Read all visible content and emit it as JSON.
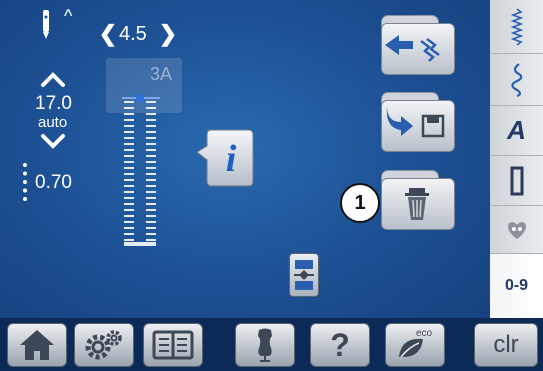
{
  "header": {
    "needle_caret": "^",
    "width_value": "4.5"
  },
  "stitch": {
    "number": "3A",
    "length_value": "17.0",
    "length_mode": "auto",
    "balance_value": "0.70"
  },
  "callout": {
    "number": "1"
  },
  "sidebar": {
    "items": [
      {
        "name": "practical-stitches",
        "icon": "zigzag-icon"
      },
      {
        "name": "decorative-stitches",
        "icon": "decorative-stitch-icon"
      },
      {
        "name": "alphabets",
        "label": "A"
      },
      {
        "name": "buttonholes",
        "icon": "buttonhole-icon"
      },
      {
        "name": "personal-program",
        "icon": "heart-icon"
      },
      {
        "name": "numbers",
        "label": "0-9"
      }
    ]
  },
  "bottombar": {
    "help_label": "?",
    "eco_label": "eco",
    "clr_label": "clr"
  },
  "colors": {
    "background": "#1c4f92",
    "bottom_bar": "#0b2a57",
    "sidebar": "#e3e6ea",
    "button": "#d8dce2",
    "info_icon": "#1f5fbf"
  }
}
